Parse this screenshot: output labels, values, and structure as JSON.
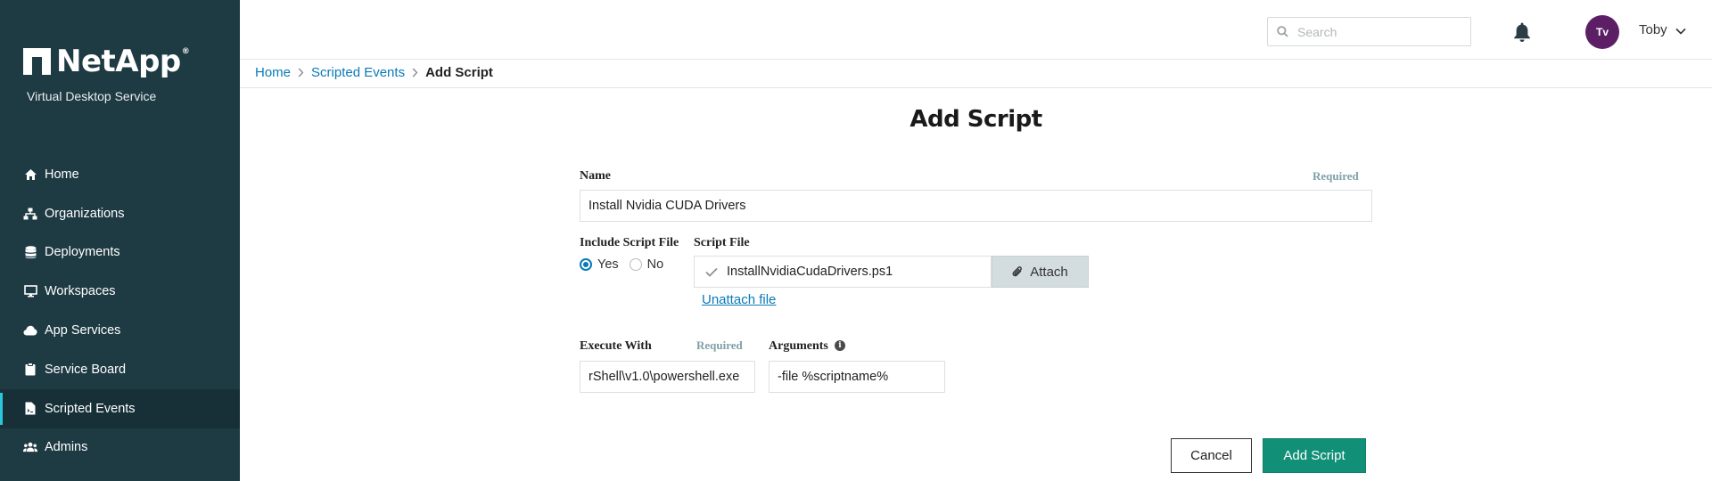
{
  "sidebar": {
    "brand": "NetApp",
    "brand_mark": "®",
    "subtitle": "Virtual Desktop Service",
    "items": [
      {
        "label": "Home",
        "icon": "home-icon"
      },
      {
        "label": "Organizations",
        "icon": "org-chart-icon"
      },
      {
        "label": "Deployments",
        "icon": "database-icon"
      },
      {
        "label": "Workspaces",
        "icon": "monitor-icon"
      },
      {
        "label": "App Services",
        "icon": "cloud-icon"
      },
      {
        "label": "Service Board",
        "icon": "clipboard-icon"
      },
      {
        "label": "Scripted Events",
        "icon": "script-file-icon",
        "active": true
      },
      {
        "label": "Admins",
        "icon": "users-icon"
      }
    ],
    "accent_color": "#29c7d8",
    "background": "#1e3a43"
  },
  "topbar": {
    "search_placeholder": "Search",
    "user_initials": "Tv",
    "user_name": "Toby",
    "avatar_color": "#5c1f66"
  },
  "breadcrumb": {
    "items": [
      "Home",
      "Scripted Events"
    ],
    "current": "Add Script"
  },
  "form": {
    "title": "Add Script",
    "name_label": "Name",
    "name_required": "Required",
    "name_value": "Install Nvidia CUDA Drivers",
    "include_label": "Include Script File",
    "include_yes": "Yes",
    "include_no": "No",
    "include_selected": "Yes",
    "script_file_label": "Script File",
    "script_file_value": "InstallNvidiaCudaDrivers.ps1",
    "attach_label": "Attach",
    "unattach_label": "Unattach file",
    "execute_label": "Execute With",
    "execute_required": "Required",
    "execute_value": "rShell\\v1.0\\powershell.exe",
    "arguments_label": "Arguments",
    "arguments_value": "-file %scriptname%",
    "cancel_label": "Cancel",
    "submit_label": "Add Script",
    "primary_color": "#119077",
    "link_color": "#0a7ab8"
  }
}
